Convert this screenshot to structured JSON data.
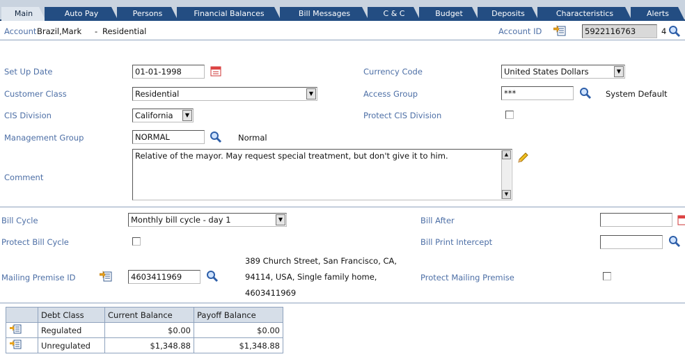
{
  "tabs": [
    "Main",
    "Auto Pay",
    "Persons",
    "Financial Balances",
    "Bill Messages",
    "C & C",
    "Budget",
    "Deposits",
    "Characteristics",
    "Alerts"
  ],
  "account": {
    "label": "Account",
    "name": "Brazil,Mark",
    "separator": "-",
    "type": "Residential",
    "id_label": "Account ID",
    "id_value": "5922116763",
    "id_suffix": "4"
  },
  "main": {
    "setup_date_label": "Set Up Date",
    "setup_date_value": "01-01-1998",
    "customer_class_label": "Customer Class",
    "customer_class_value": "Residential",
    "cis_division_label": "CIS Division",
    "cis_division_value": "California",
    "management_group_label": "Management Group",
    "management_group_value": "NORMAL",
    "management_group_desc": "Normal",
    "comment_label": "Comment",
    "comment_value": "Relative of the mayor.  May request special treatment, but don't give it to him.",
    "currency_code_label": "Currency Code",
    "currency_code_value": "United States Dollars",
    "access_group_label": "Access Group",
    "access_group_value": "***",
    "access_group_desc": "System Default",
    "protect_cis_label": "Protect CIS Division"
  },
  "bill": {
    "bill_cycle_label": "Bill Cycle",
    "bill_cycle_value": "Monthly bill cycle - day 1",
    "protect_bill_cycle_label": "Protect Bill Cycle",
    "mailing_premise_label": "Mailing Premise ID",
    "mailing_premise_value": "4603411969",
    "address_line1": "389 Church Street, San Francisco, CA,",
    "address_line2": "94114, USA, Single family home,",
    "address_line3": "4603411969",
    "bill_after_label": "Bill After",
    "bill_print_intercept_label": "Bill Print Intercept",
    "protect_mailing_label": "Protect Mailing Premise"
  },
  "debt_table": {
    "headers": [
      "Debt Class",
      "Current Balance",
      "Payoff Balance"
    ],
    "rows": [
      {
        "debt_class": "Regulated",
        "current": "$0.00",
        "payoff": "$0.00"
      },
      {
        "debt_class": "Unregulated",
        "current": "$1,348.88",
        "payoff": "$1,348.88"
      }
    ]
  },
  "colors": {
    "tab_bg": "#234d82",
    "tab_active_bg": "#dfe6ee",
    "label_blue": "#4d6fa6",
    "border": "#8ea2bd"
  }
}
